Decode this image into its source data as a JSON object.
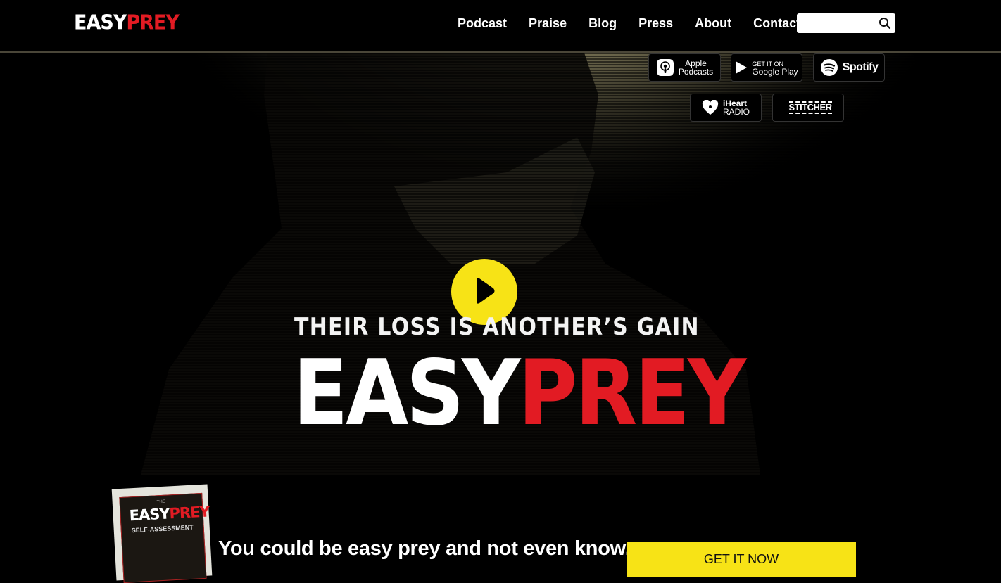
{
  "header": {
    "logo": {
      "white": "EASY",
      "red": "PREY"
    },
    "nav": [
      "Podcast",
      "Praise",
      "Blog",
      "Press",
      "About",
      "Contact"
    ],
    "search": {
      "placeholder": "",
      "icon": "search-icon"
    }
  },
  "platforms": {
    "apple": {
      "line1": "Apple",
      "line2": "Podcasts",
      "icon": "apple-podcasts-icon"
    },
    "google": {
      "small": "GET IT ON",
      "label": "Google Play",
      "icon": "google-play-icon"
    },
    "spotify": {
      "label": "Spotify",
      "icon": "spotify-icon"
    },
    "iheart": {
      "line1": "iHeart",
      "line2": "RADIO",
      "icon": "iheart-icon"
    },
    "stitcher": {
      "label": "STITCHER",
      "icon": "stitcher-icon"
    }
  },
  "hero": {
    "tagline": "THEIR LOSS IS ANOTHER’S GAIN",
    "title_white": "EASY",
    "title_red": "PREY",
    "play_icon": "play-icon"
  },
  "promo": {
    "book": {
      "the": "THE",
      "white": "EASY",
      "red": "PREY",
      "sub": "SELF-ASSESSMENT"
    },
    "text": "You could be easy prey and not even know.",
    "button": "GET IT NOW"
  },
  "colors": {
    "accent_red": "#e21b23",
    "accent_yellow": "#f7e316",
    "background": "#000000"
  }
}
